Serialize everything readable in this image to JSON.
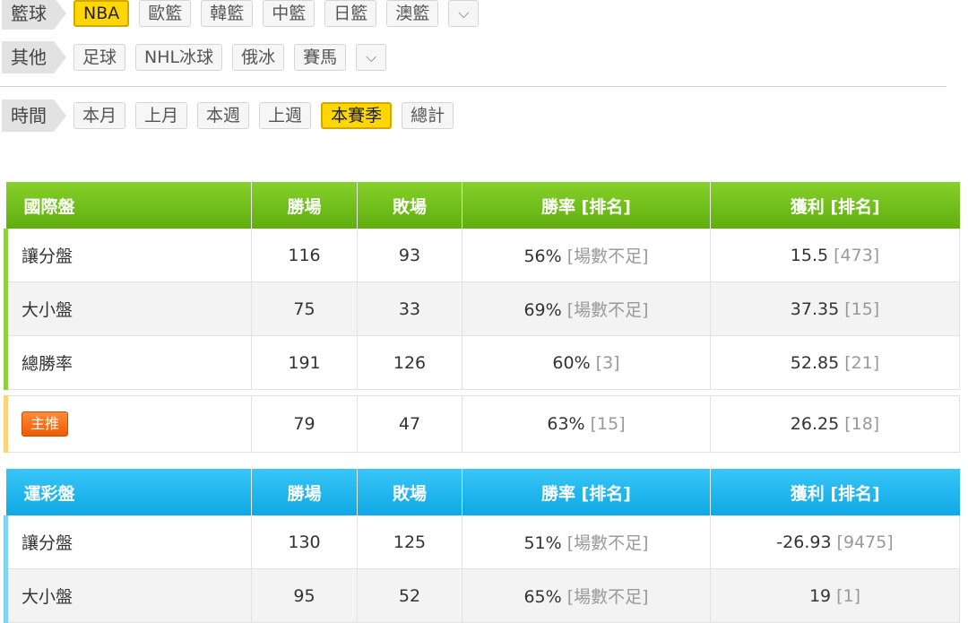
{
  "filters": {
    "basketball": {
      "label": "籃球",
      "chips": [
        "NBA",
        "歐籃",
        "韓籃",
        "中籃",
        "日籃",
        "澳籃"
      ],
      "active": "NBA"
    },
    "other": {
      "label": "其他",
      "chips": [
        "足球",
        "NHL冰球",
        "俄冰",
        "賽馬"
      ]
    },
    "time": {
      "label": "時間",
      "chips": [
        "本月",
        "上月",
        "本週",
        "上週",
        "本賽季",
        "總計"
      ],
      "active": "本賽季"
    }
  },
  "intl": {
    "headers": [
      "國際盤",
      "勝場",
      "敗場",
      "勝率 [排名]",
      "獲利 [排名]"
    ],
    "rows": [
      {
        "name": "讓分盤",
        "win": "116",
        "loss": "93",
        "rate": "56%",
        "rate_rank": "[場數不足]",
        "profit": "15.5",
        "profit_rank": "[473]"
      },
      {
        "name": "大小盤",
        "win": "75",
        "loss": "33",
        "rate": "69%",
        "rate_rank": "[場數不足]",
        "profit": "37.35",
        "profit_rank": "[15]"
      },
      {
        "name": "總勝率",
        "win": "191",
        "loss": "126",
        "rate": "60%",
        "rate_rank": "[3]",
        "profit": "52.85",
        "profit_rank": "[21]"
      }
    ],
    "featured": {
      "badge": "主推",
      "win": "79",
      "loss": "47",
      "rate": "63%",
      "rate_rank": "[15]",
      "profit": "26.25",
      "profit_rank": "[18]"
    }
  },
  "lottery": {
    "headers": [
      "運彩盤",
      "勝場",
      "敗場",
      "勝率 [排名]",
      "獲利 [排名]"
    ],
    "rows": [
      {
        "name": "讓分盤",
        "win": "130",
        "loss": "125",
        "rate": "51%",
        "rate_rank": "[場數不足]",
        "profit": "-26.93",
        "profit_rank": "[9475]"
      },
      {
        "name": "大小盤",
        "win": "95",
        "loss": "52",
        "rate": "65%",
        "rate_rank": "[場數不足]",
        "profit": "19",
        "profit_rank": "[1]"
      }
    ]
  },
  "icons": {
    "expand": "chevron-down-icon"
  },
  "colors": {
    "active_chip": "#ffd700",
    "intl_header": "#6dbd18",
    "lottery_header": "#1ab3ee",
    "badge": "#f26a10"
  }
}
